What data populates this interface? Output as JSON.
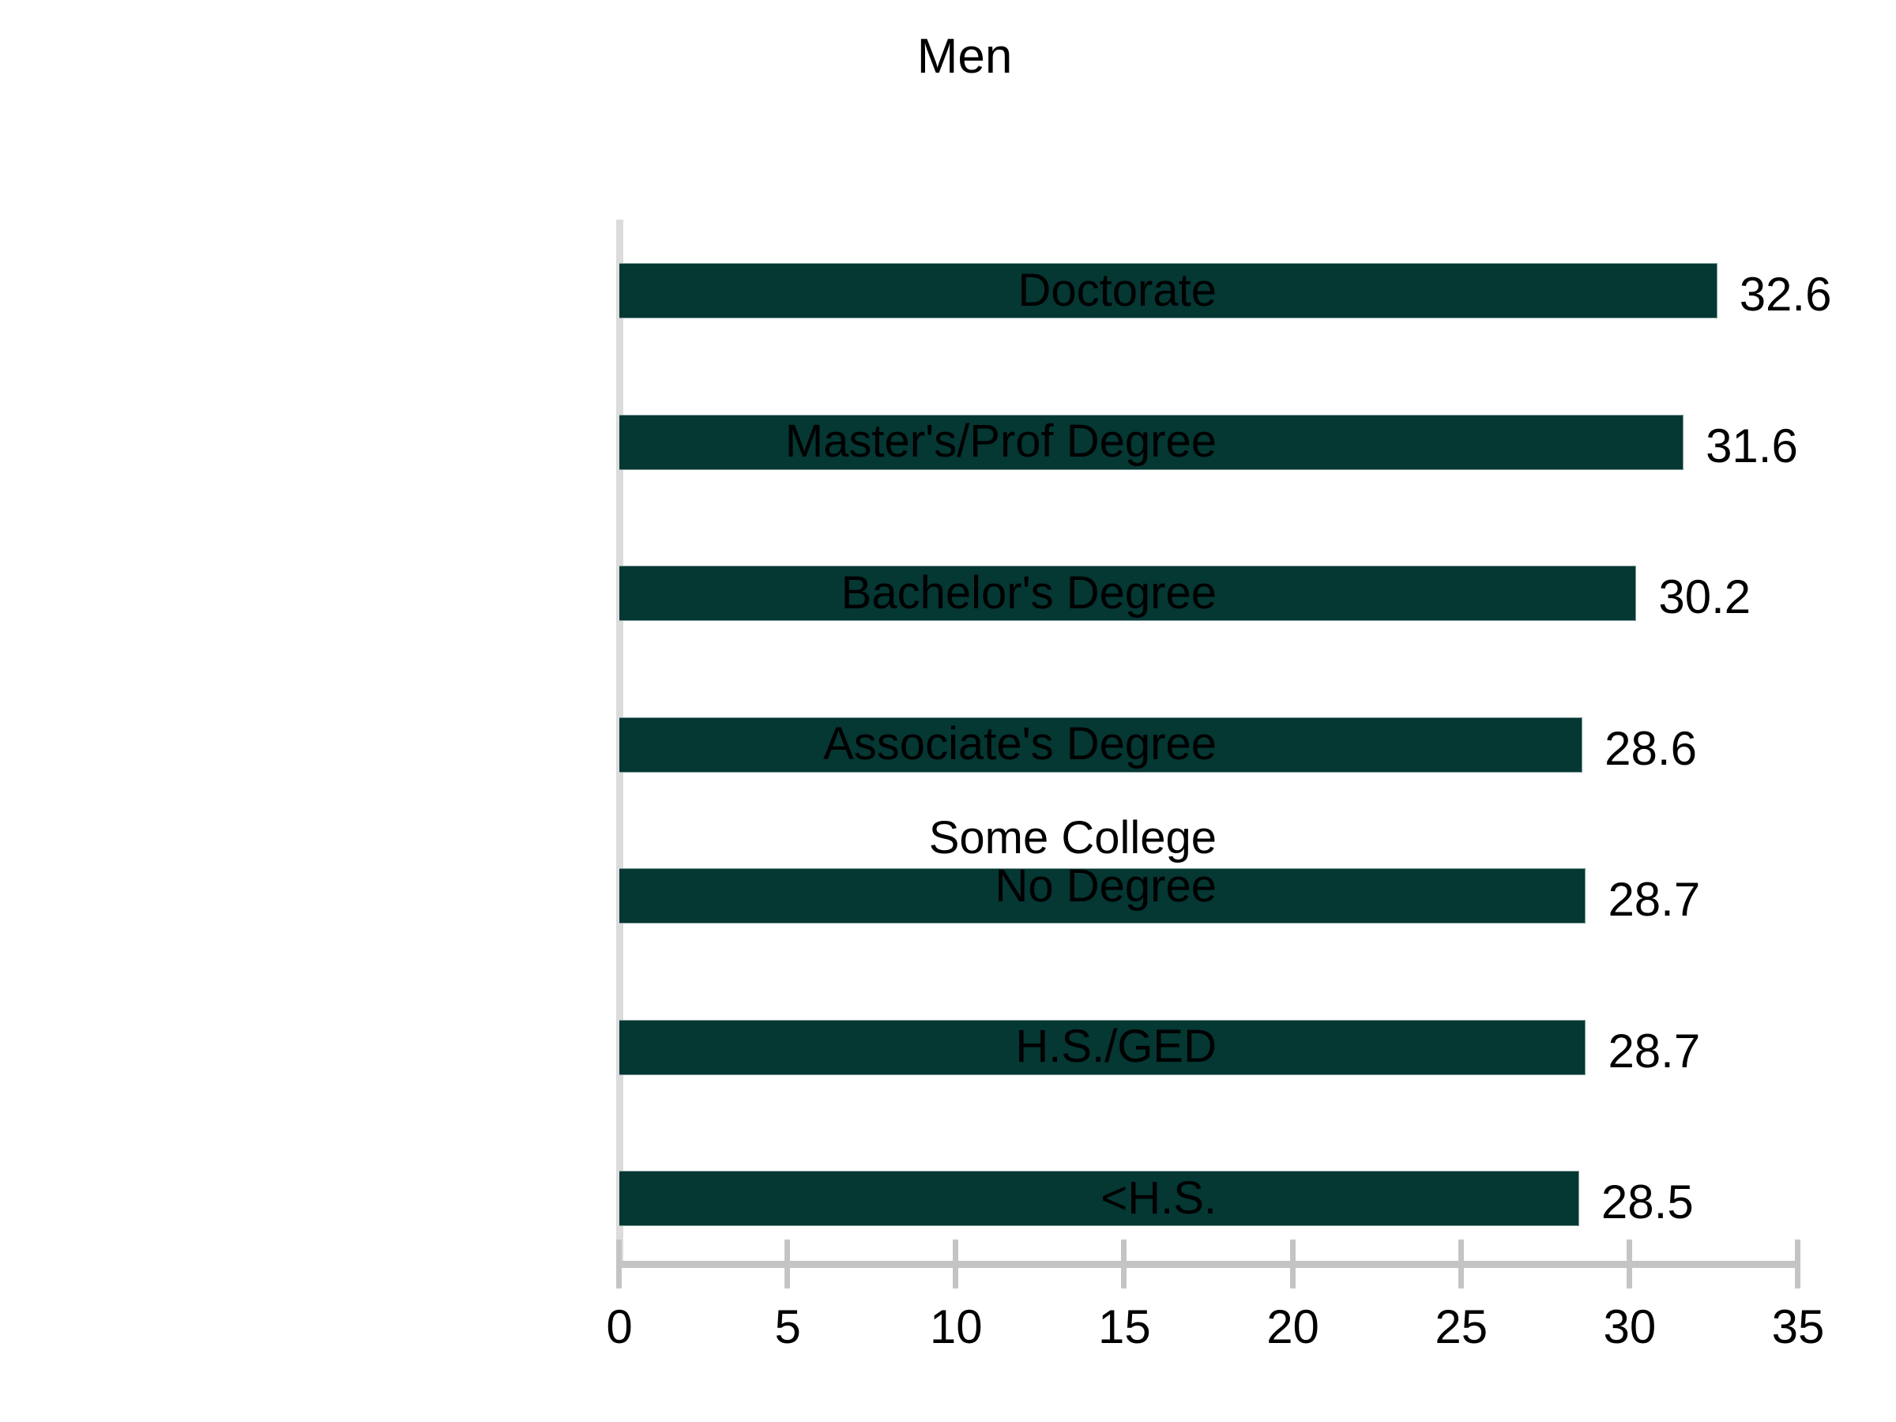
{
  "chart_data": {
    "type": "bar",
    "orientation": "horizontal",
    "title": "Men",
    "xlabel": "",
    "ylabel": "",
    "xlim": [
      0,
      35
    ],
    "xticks": [
      "0",
      "5",
      "10",
      "15",
      "20",
      "25",
      "30",
      "35"
    ],
    "grid": false,
    "legend": "none",
    "bar_color": "#053733",
    "axis_color": "#c4c4c4",
    "text_color": "#000000",
    "background": "#ffffff",
    "categories": [
      "Doctorate",
      "Master's/Prof Degree",
      "Bachelor's Degree",
      "Associate's Degree",
      "Some College\nNo Degree",
      "H.S./GED",
      "<H.S."
    ],
    "values": [
      32.6,
      31.6,
      30.2,
      28.6,
      28.7,
      28.7,
      28.5
    ],
    "value_labels": [
      "32.6",
      "31.6",
      "30.2",
      "28.6",
      "28.7",
      "28.7",
      "28.5"
    ]
  }
}
